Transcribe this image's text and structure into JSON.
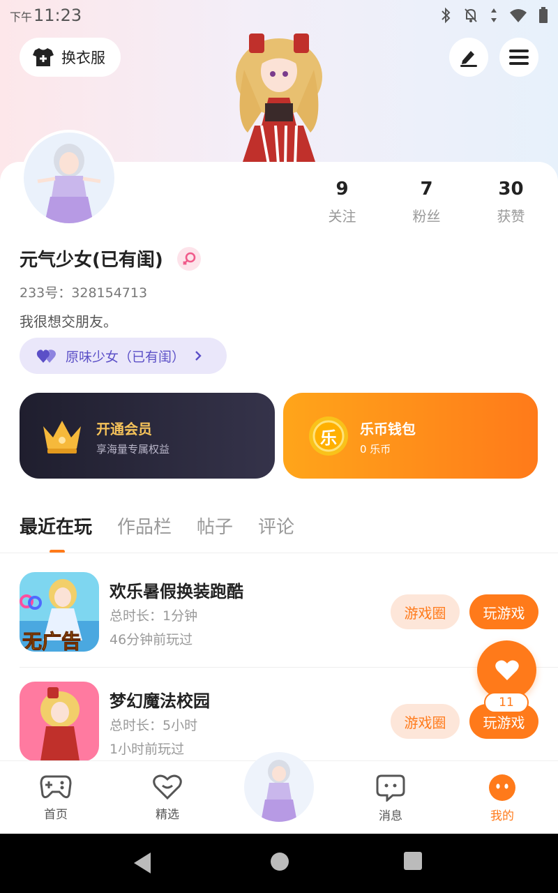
{
  "status_bar": {
    "ampm": "下午",
    "time": "11:23"
  },
  "header": {
    "outfit_button": "换衣服"
  },
  "profile": {
    "username": "元气少女(已有闺)",
    "uid": "233号：328154713",
    "bio": "我很想交朋友。",
    "tag": "原味少女（已有闺）",
    "stats": [
      {
        "value": "9",
        "label": "关注"
      },
      {
        "value": "7",
        "label": "粉丝"
      },
      {
        "value": "30",
        "label": "获赞"
      }
    ]
  },
  "promos": {
    "vip": {
      "title": "开通会员",
      "subtitle": "享海量专属权益"
    },
    "wallet": {
      "coin_glyph": "乐",
      "title": "乐币钱包",
      "subtitle": "0 乐币"
    }
  },
  "tabs": [
    "最近在玩",
    "作品栏",
    "帖子",
    "评论"
  ],
  "games": [
    {
      "icon_text": "无广告",
      "title": "欢乐暑假换装跑酷",
      "duration": "总时长：1分钟",
      "last_played": "46分钟前玩过",
      "circle_label": "游戏圈",
      "play_label": "玩游戏"
    },
    {
      "title": "梦幻魔法校园",
      "duration": "总时长：5小时",
      "last_played": "1小时前玩过",
      "circle_label": "游戏圈",
      "play_label": "玩游戏"
    }
  ],
  "fab": {
    "badge": "11"
  },
  "bottom_nav": [
    {
      "label": "首页"
    },
    {
      "label": "精选"
    },
    {
      "label": "消息"
    },
    {
      "label": "我的"
    }
  ],
  "colors": {
    "accent": "#ff7a1a",
    "tag_text": "#5b4fc7",
    "vip_gold": "#f6c35a"
  }
}
